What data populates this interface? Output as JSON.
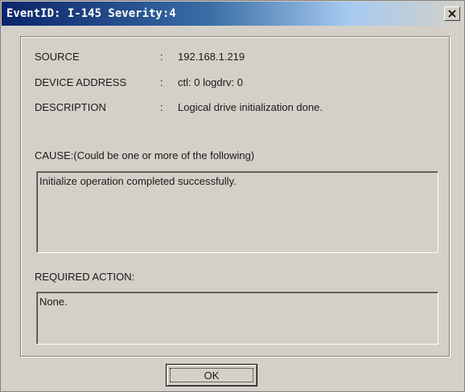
{
  "window": {
    "title": "EventID: I-145 Severity:4",
    "close_icon": "close-icon"
  },
  "details": [
    {
      "label": "SOURCE",
      "sep": ":",
      "value": "192.168.1.219"
    },
    {
      "label": "DEVICE ADDRESS",
      "sep": ":",
      "value": "ctl: 0 logdrv: 0"
    },
    {
      "label": "DESCRIPTION",
      "sep": ":",
      "value": "Logical drive initialization done."
    }
  ],
  "cause": {
    "label": "CAUSE:(Could be one or more of the following)",
    "text": "Initialize operation completed successfully."
  },
  "required_action": {
    "label": "REQUIRED ACTION:",
    "text": "None."
  },
  "buttons": {
    "ok_label": "OK"
  }
}
